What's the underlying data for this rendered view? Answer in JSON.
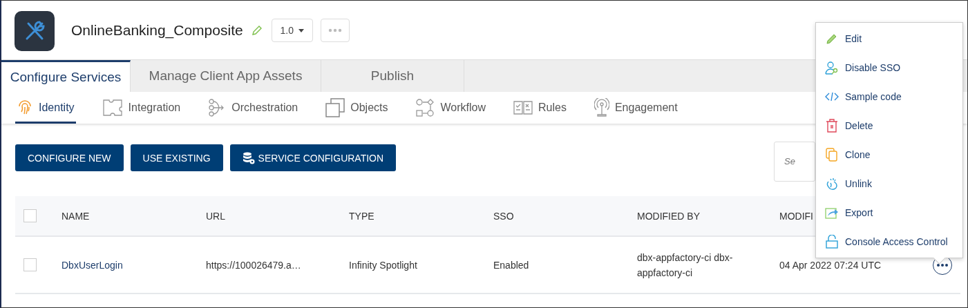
{
  "app": {
    "title": "OnlineBanking_Composite",
    "version": "1.0"
  },
  "tabs": [
    {
      "label": "Configure Services",
      "selected": true
    },
    {
      "label": "Manage Client App Assets",
      "selected": false
    },
    {
      "label": "Publish",
      "selected": false
    }
  ],
  "service_tabs": [
    {
      "label": "Identity",
      "kind": "fingerprint",
      "selected": true
    },
    {
      "label": "Integration",
      "kind": "puzzle",
      "selected": false
    },
    {
      "label": "Orchestration",
      "kind": "orchestration",
      "selected": false
    },
    {
      "label": "Objects",
      "kind": "objects",
      "selected": false
    },
    {
      "label": "Workflow",
      "kind": "workflow",
      "selected": false
    },
    {
      "label": "Rules",
      "kind": "rules",
      "selected": false
    },
    {
      "label": "Engagement",
      "kind": "antenna",
      "selected": false
    }
  ],
  "actions": [
    {
      "label": "CONFIGURE NEW",
      "kind": "plain"
    },
    {
      "label": "USE EXISTING",
      "kind": "plain"
    },
    {
      "label": "SERVICE CONFIGURATION",
      "kind": "database"
    }
  ],
  "search": {
    "placeholder": "Se"
  },
  "table": {
    "select_all_checked": false,
    "columns": [
      "NAME",
      "URL",
      "TYPE",
      "SSO",
      "MODIFIED BY",
      "MODIFI"
    ],
    "rows": [
      {
        "checked": false,
        "cells": [
          "DbxUserLogin",
          "https://100026479.a…",
          "Infinity Spotlight",
          "Enabled",
          "dbx-appfactory-ci dbx-appfactory-ci",
          "04 Apr 2022 07:24 UTC"
        ]
      }
    ]
  },
  "context_menu": [
    {
      "label": "Edit",
      "kind": "edit"
    },
    {
      "label": "Disable SSO",
      "kind": "sso"
    },
    {
      "label": "Sample code",
      "kind": "code"
    },
    {
      "label": "Delete",
      "kind": "delete"
    },
    {
      "label": "Clone",
      "kind": "clone"
    },
    {
      "label": "Unlink",
      "kind": "unlink"
    },
    {
      "label": "Export",
      "kind": "export"
    },
    {
      "label": "Console Access Control",
      "kind": "lock"
    }
  ]
}
